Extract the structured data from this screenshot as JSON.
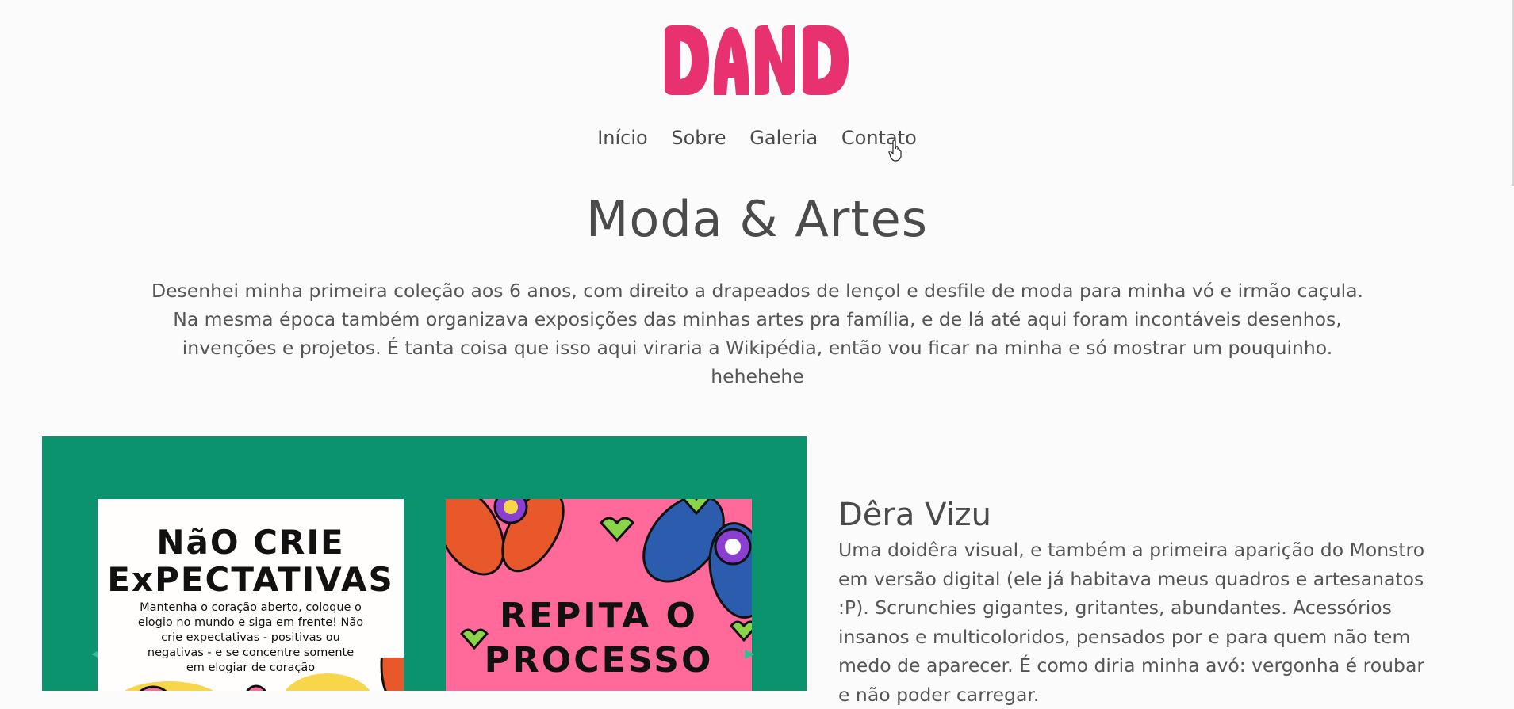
{
  "brand": {
    "logo_text": "DAND",
    "logo_color": "#e8316f"
  },
  "nav": {
    "items": [
      "Início",
      "Sobre",
      "Galeria",
      "Contato"
    ]
  },
  "hero": {
    "title": "Moda & Artes",
    "intro": "Desenhei minha primeira coleção aos 6 anos, com direito a drapeados de lençol e desfile de moda para minha vó e irmão caçula. Na mesma época também organizava exposições das minhas artes pra família, e de lá até aqui foram incontáveis desenhos, invenções e projetos. É tanta coisa que isso aqui viraria a Wikipédia, então vou ficar na minha e só mostrar um pouquinho. hehehehe"
  },
  "gallery": {
    "bg_color": "#0a936d",
    "card1": {
      "line1": "NãO CRIE",
      "line2": "ExPECTATIVAS",
      "small": "Mantenha o coração aberto, coloque o elogio no mundo e siga em frente! Não crie expectativas - positivas ou negativas - e se concentre somente em elogiar de coração"
    },
    "card2": {
      "line1": "REPITA O",
      "line2": "PROCESSO",
      "bg_color": "#ff6a9a"
    }
  },
  "feature": {
    "title": "Dêra Vizu",
    "text": "Uma doidêra visual, e também a primeira aparição do Monstro em versão digital (ele já habitava meus quadros e artesanatos :P). Scrunchies gigantes, gritantes, abundantes. Acessórios insanos e multicoloridos, pensados por e para quem não tem medo de aparecer. É como diria minha avó: vergonha é roubar e não poder carregar."
  }
}
